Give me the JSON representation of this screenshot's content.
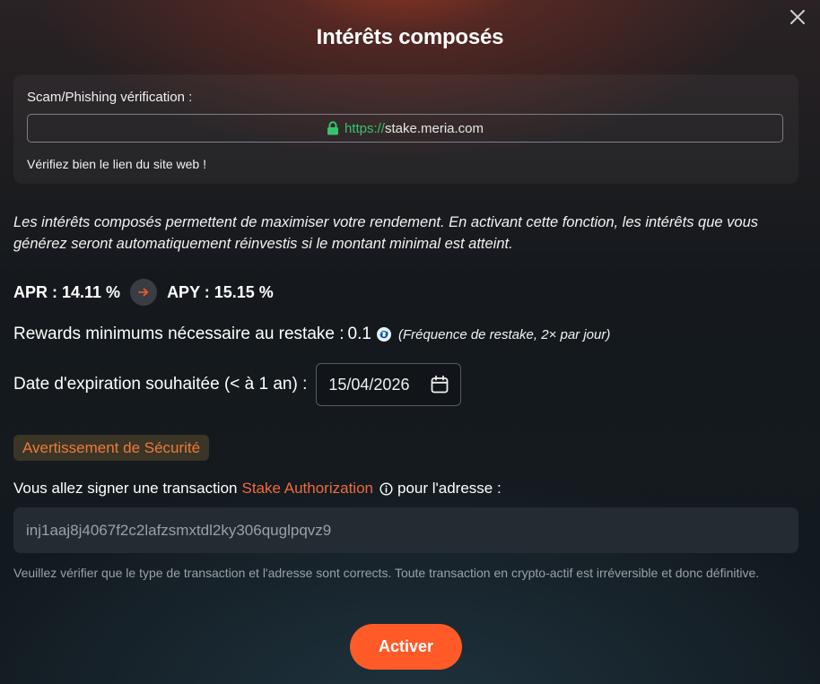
{
  "modal": {
    "title": "Intérêts composés",
    "close_icon": "close-icon"
  },
  "verification": {
    "label": "Scam/Phishing vérification :",
    "url_protocol": "https://",
    "url_host": "stake.meria.com",
    "warning": "Vérifiez bien le lien du site web !",
    "lock_icon": "lock-icon",
    "lock_color": "#35c46b"
  },
  "description": "Les intérêts composés permettent de maximiser votre rendement. En activant cette fonction, les intérêts que vous générez seront automatiquement réinvestis si le montant minimal est atteint.",
  "rates": {
    "apr": "APR : 14.11 %",
    "apy": "APY : 15.15 %",
    "arrow_icon": "arrow-right-icon"
  },
  "rewards": {
    "label": "Rewards minimums nécessaire au restake :",
    "amount": "0.1",
    "token_icon": "injective-token-icon",
    "note": "(Fréquence de restake, 2× par jour)"
  },
  "expiry": {
    "label": "Date d'expiration souhaitée (< à 1 an) :",
    "value": "15/04/2026",
    "calendar_icon": "calendar-icon"
  },
  "security": {
    "badge": "Avertissement de Sécurité",
    "sign_prefix": "Vous allez signer une transaction",
    "transaction_type": "Stake Authorization",
    "sign_suffix": "pour l'adresse :",
    "info_icon": "info-icon",
    "address": "inj1aaj8j4067f2c2lafzsmxtdl2ky306quglpqvz9",
    "disclaimer": "Veuillez vérifier que le type de transaction et l'adresse sont corrects. Toute transaction en crypto-actif est irréversible et donc définitive."
  },
  "actions": {
    "activate_label": "Activer"
  },
  "colors": {
    "accent": "#ff5a28",
    "secure_green": "#35c46b",
    "warning_orange": "#ee7a3a"
  }
}
